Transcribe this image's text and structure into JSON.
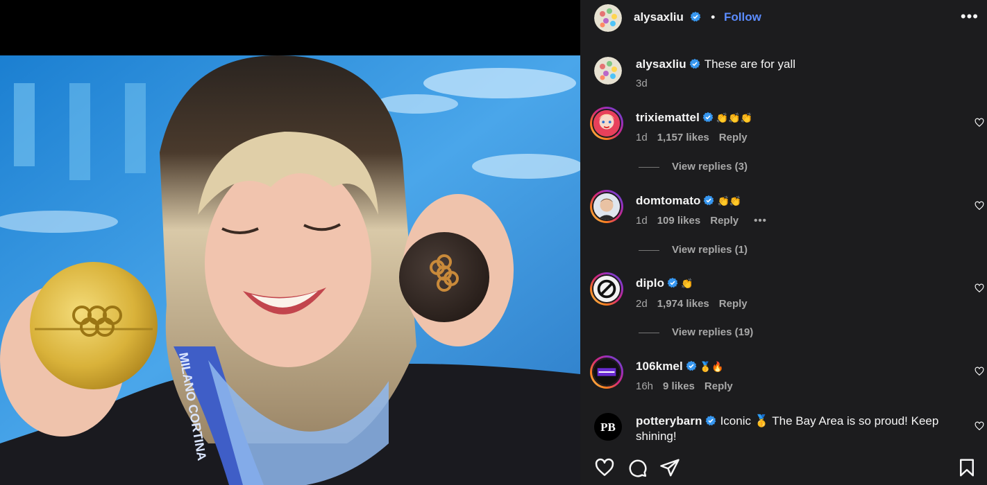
{
  "header": {
    "username": "alysaxliu",
    "follow_label": "Follow",
    "separator": "•",
    "more_glyph": "•••"
  },
  "caption": {
    "username": "alysaxliu",
    "text": "These are for yall",
    "time": "3d"
  },
  "photo": {
    "medal_text": "MILANO CORTINA"
  },
  "comments": [
    {
      "username": "trixiemattel",
      "text": "👏👏👏",
      "time": "1d",
      "likes": "1,157 likes",
      "reply": "Reply",
      "view_replies": "View replies (3)"
    },
    {
      "username": "domtomato",
      "text": "👏👏",
      "time": "1d",
      "likes": "109 likes",
      "reply": "Reply",
      "more": "•••",
      "view_replies": "View replies (1)"
    },
    {
      "username": "diplo",
      "text": "👏",
      "time": "2d",
      "likes": "1,974 likes",
      "reply": "Reply",
      "view_replies": "View replies (19)"
    },
    {
      "username": "106kmel",
      "text": "🥇🔥",
      "time": "16h",
      "likes": "9 likes",
      "reply": "Reply"
    },
    {
      "username": "potterybarn",
      "text": "Iconic 🥇 The Bay Area is so proud! Keep shining!",
      "avatar_text": "PB"
    }
  ],
  "icons": {
    "verified": "verified-badge-icon",
    "heart": "heart-icon",
    "comment": "comment-icon",
    "share": "share-icon",
    "save": "bookmark-icon"
  },
  "colors": {
    "panel_bg": "#1c1c1e",
    "link_blue": "#5b8cff",
    "verified_blue": "#3797f0",
    "muted": "#a8a8a8"
  }
}
